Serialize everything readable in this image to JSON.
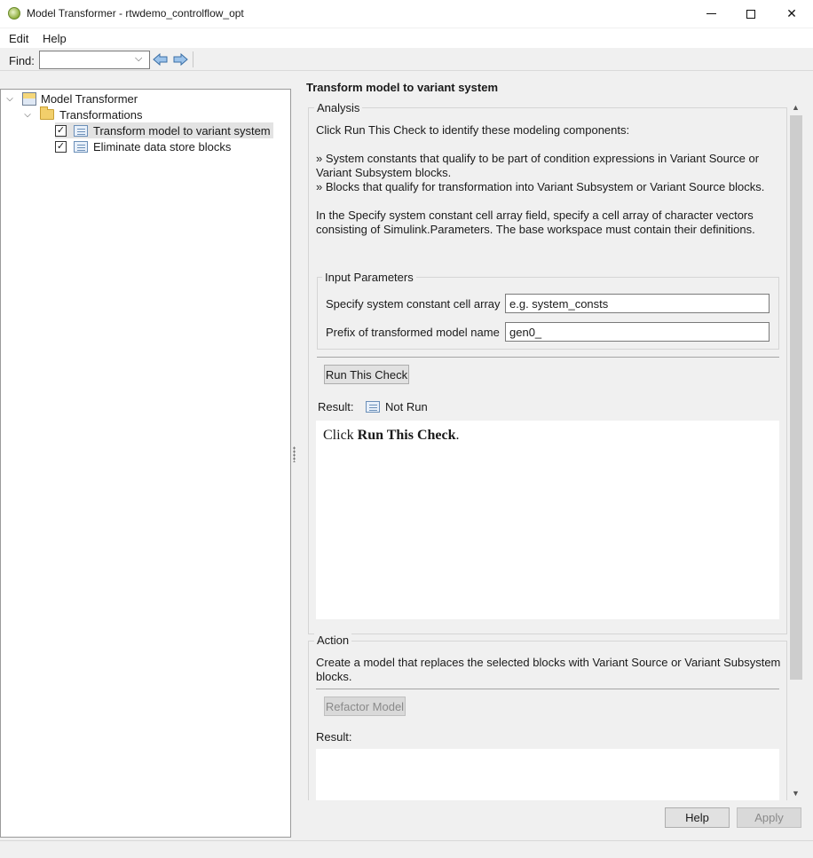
{
  "window": {
    "title": "Model Transformer - rtwdemo_controlflow_opt",
    "controls": [
      "minimize-icon",
      "maximize-icon",
      "close-icon"
    ]
  },
  "menu": {
    "edit": "Edit",
    "help": "Help"
  },
  "toolbar": {
    "find_label": "Find:",
    "find_value": ""
  },
  "tree": {
    "root": "Model Transformer",
    "folder": "Transformations",
    "items": [
      {
        "label": "Transform model to variant system",
        "checked": true,
        "selected": true
      },
      {
        "label": "Eliminate data store blocks",
        "checked": true,
        "selected": false
      }
    ]
  },
  "panel": {
    "header": "Transform model to variant system",
    "analysis": {
      "legend": "Analysis",
      "intro": "Click Run This Check to identify these modeling components:",
      "bullet1": "» System constants that qualify to be part of condition expressions in Variant Source or Variant Subsystem blocks.",
      "bullet2": "» Blocks that qualify for transformation into Variant Subsystem or Variant Source blocks.",
      "specify_text": "In the Specify system constant cell array field, specify a cell array of character vectors consisting of Simulink.Parameters. The base workspace must contain their definitions.",
      "input_params": {
        "legend": "Input Parameters",
        "field1_label": "Specify system constant cell array",
        "field1_value": "e.g. system_consts",
        "field2_label": "Prefix of transformed model name",
        "field2_value": "gen0_"
      },
      "run_button": "Run This Check",
      "result_label": "Result:",
      "result_status": "Not Run",
      "result_text_prefix": "Click ",
      "result_text_bold": "Run This Check",
      "result_text_suffix": "."
    },
    "action": {
      "legend": "Action",
      "text": "Create a model that replaces the selected blocks with Variant Source or Variant Subsystem blocks.",
      "refactor_button": "Refactor Model",
      "result_label": "Result:"
    }
  },
  "buttons": {
    "help": "Help",
    "apply": "Apply"
  },
  "colors": {
    "selection": "#e3e3e3",
    "panel_bg": "#f0f0f0",
    "disabled_text": "#8a8a8a"
  }
}
